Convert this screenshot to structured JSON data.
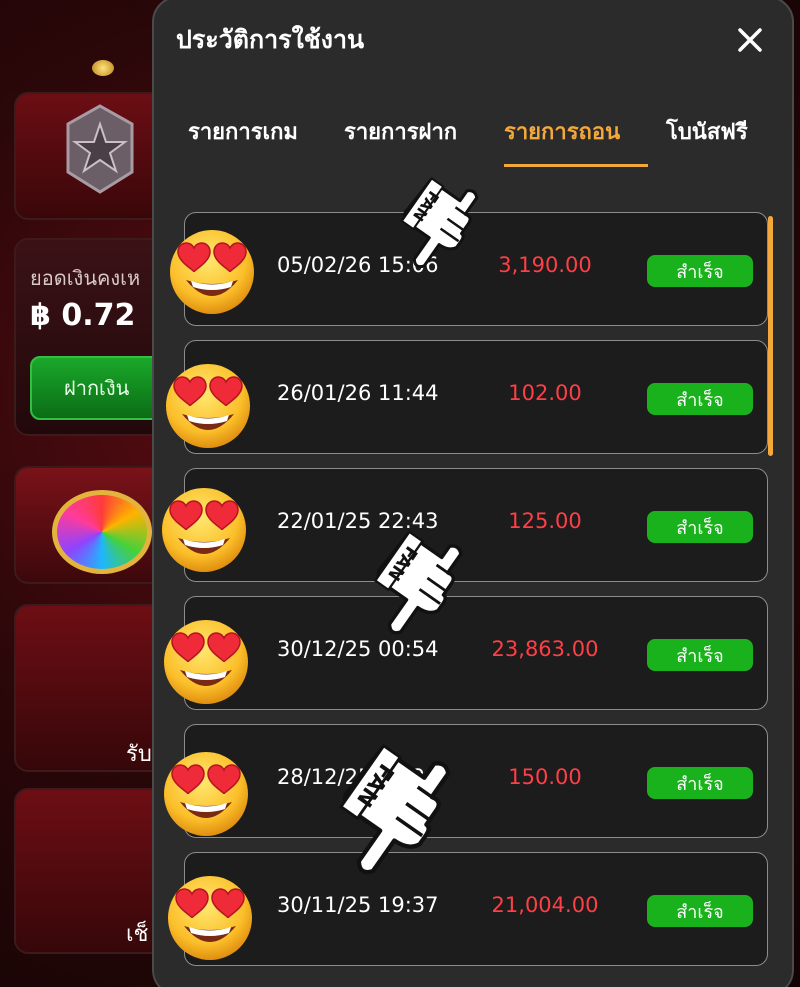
{
  "background": {
    "balance_label": "ยอดเงินคงเห",
    "balance_value": "฿ 0.72",
    "deposit_label": "ฝากเงิน",
    "promo_text": "รับ",
    "calendar_text": "เช็"
  },
  "modal": {
    "title": "ประวัติการใช้งาน",
    "tabs": [
      {
        "label": "รายการเกม"
      },
      {
        "label": "รายการฝาก"
      },
      {
        "label": "รายการถอน"
      },
      {
        "label": "โบนัสฟรี"
      }
    ],
    "active_tab": "รายการถอน",
    "rows": [
      {
        "datetime": "05/02/26 15:06",
        "amount": "3,190.00",
        "status": "สำเร็จ"
      },
      {
        "datetime": "26/01/26 11:44",
        "amount": "102.00",
        "status": "สำเร็จ"
      },
      {
        "datetime": "22/01/25 22:43",
        "amount": "125.00",
        "status": "สำเร็จ"
      },
      {
        "datetime": "30/12/25 00:54",
        "amount": "23,863.00",
        "status": "สำเร็จ"
      },
      {
        "datetime": "28/12/25 19:20",
        "amount": "150.00",
        "status": "สำเร็จ"
      },
      {
        "datetime": "30/11/25 19:37",
        "amount": "21,004.00",
        "status": "สำเร็จ"
      }
    ]
  },
  "stickers": {
    "hand_text": "FAN",
    "emoji": "heart-eyes-emoji"
  },
  "colors": {
    "accent": "#f2a83a",
    "amount": "#ff3f46",
    "status_green": "#19b21c",
    "panel": "#2b2b2b"
  }
}
